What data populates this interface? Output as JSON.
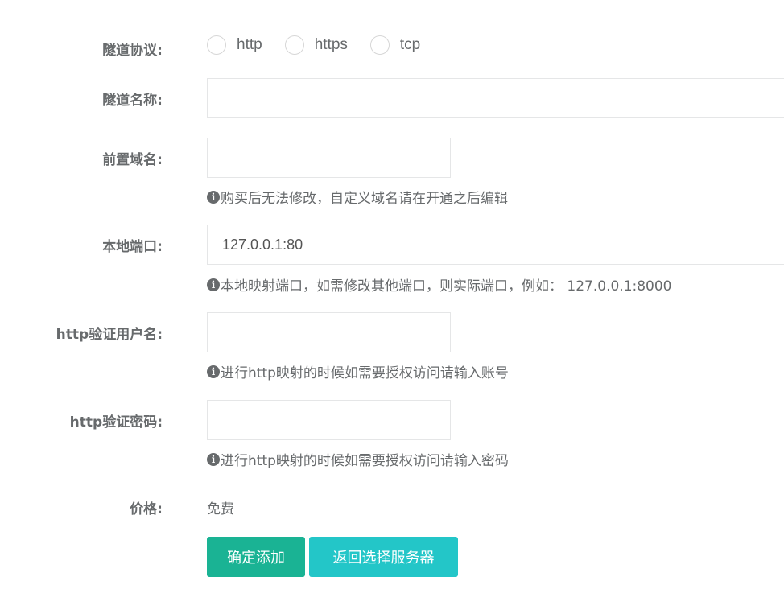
{
  "protocol": {
    "label": "隧道协议:",
    "options": [
      "http",
      "https",
      "tcp"
    ]
  },
  "tunnel_name": {
    "label": "隧道名称:",
    "value": ""
  },
  "prefix_domain": {
    "label": "前置域名:",
    "value": "",
    "help": "购买后无法修改，自定义域名请在开通之后编辑"
  },
  "local_port": {
    "label": "本地端口:",
    "value": "127.0.0.1:80",
    "help": "本地映射端口，如需修改其他端口，则实际端口，例如： 127.0.0.1:8000"
  },
  "http_user": {
    "label": "http验证用户名:",
    "value": "",
    "help": "进行http映射的时候如需要授权访问请输入账号"
  },
  "http_password": {
    "label": "http验证密码:",
    "value": "",
    "help": "进行http映射的时候如需要授权访问请输入密码"
  },
  "price": {
    "label": "价格:",
    "value": "免费"
  },
  "buttons": {
    "confirm": "确定添加",
    "back": "返回选择服务器"
  },
  "colors": {
    "primary": "#1ab394",
    "info": "#23c6c8",
    "text": "#676a6c",
    "border": "#e5e6e7"
  }
}
